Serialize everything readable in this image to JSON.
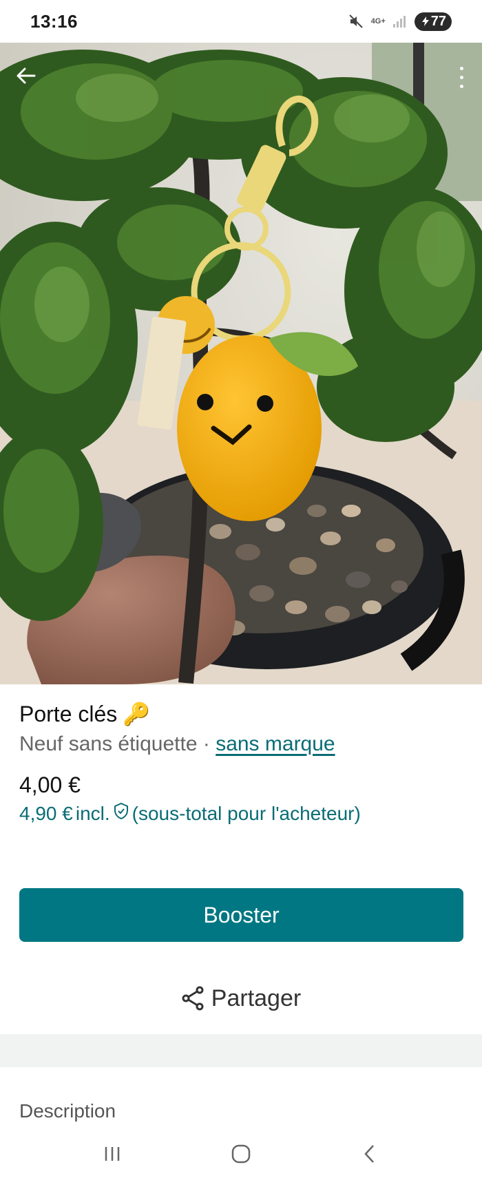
{
  "status_bar": {
    "time": "13:16",
    "network": "4G+",
    "battery": "77",
    "icons": [
      "mute-icon",
      "signal-icon",
      "battery-icon"
    ]
  },
  "photo": {
    "back_icon": "arrow-left-icon",
    "menu_icon": "more-vertical-icon"
  },
  "item": {
    "title": "Porte clés",
    "title_emoji": "🔑",
    "condition": "Neuf sans étiquette",
    "separator": " · ",
    "brand": "sans marque",
    "price": "4,00 €",
    "buyer_price": "4,90 €",
    "buyer_incl": "incl.",
    "buyer_note": "(sous-total pour l'acheteur)"
  },
  "actions": {
    "booster_label": "Booster",
    "share_label": "Partager"
  },
  "description": {
    "title": "Description"
  },
  "colors": {
    "accent": "#007782",
    "link": "#0a6c75"
  }
}
